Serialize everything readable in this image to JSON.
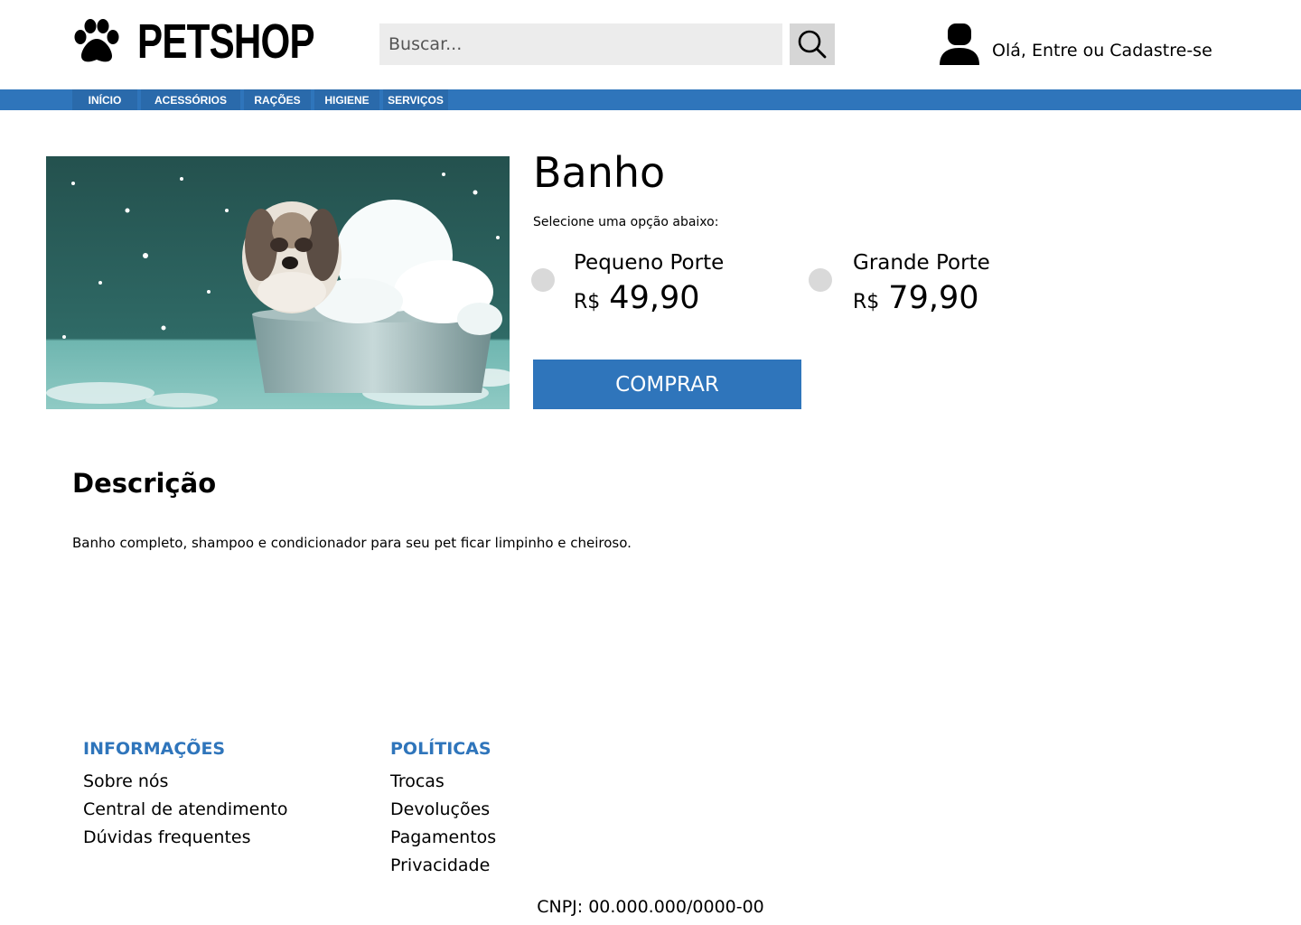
{
  "brand": {
    "name": "PETSHOP",
    "icon": "paw-icon"
  },
  "search": {
    "placeholder": "Buscar...",
    "icon": "search-icon"
  },
  "account": {
    "label": "Olá, Entre ou Cadastre-se",
    "icon": "user-icon"
  },
  "nav": {
    "items": [
      {
        "label": "INÍCIO"
      },
      {
        "label": "ACESSÓRIOS"
      },
      {
        "label": "RAÇÕES"
      },
      {
        "label": "HIGIENE"
      },
      {
        "label": "SERVIÇOS"
      }
    ]
  },
  "product": {
    "title": "Banho",
    "select_hint": "Selecione uma opção abaixo:",
    "options": [
      {
        "name": "Pequeno Porte",
        "currency": "R$",
        "price": "49,90"
      },
      {
        "name": "Grande Porte",
        "currency": "R$",
        "price": "79,90"
      }
    ],
    "buy_label": "COMPRAR"
  },
  "description": {
    "title": "Descrição",
    "text": "Banho completo, shampoo e condicionador para seu pet ficar limpinho e cheiroso."
  },
  "footer": {
    "info": {
      "heading": "INFORMAÇÕES",
      "links": [
        "Sobre nós",
        "Central de atendimento",
        "Dúvidas frequentes"
      ]
    },
    "policies": {
      "heading": "POLÍTICAS",
      "links": [
        "Trocas",
        "Devoluções",
        "Pagamentos",
        "Privacidade"
      ]
    },
    "cnpj": "CNPJ: 00.000.000/0000-00"
  },
  "colors": {
    "accent": "#2f75bb",
    "search_bg": "#ececec",
    "radio": "#d9d9d9"
  }
}
